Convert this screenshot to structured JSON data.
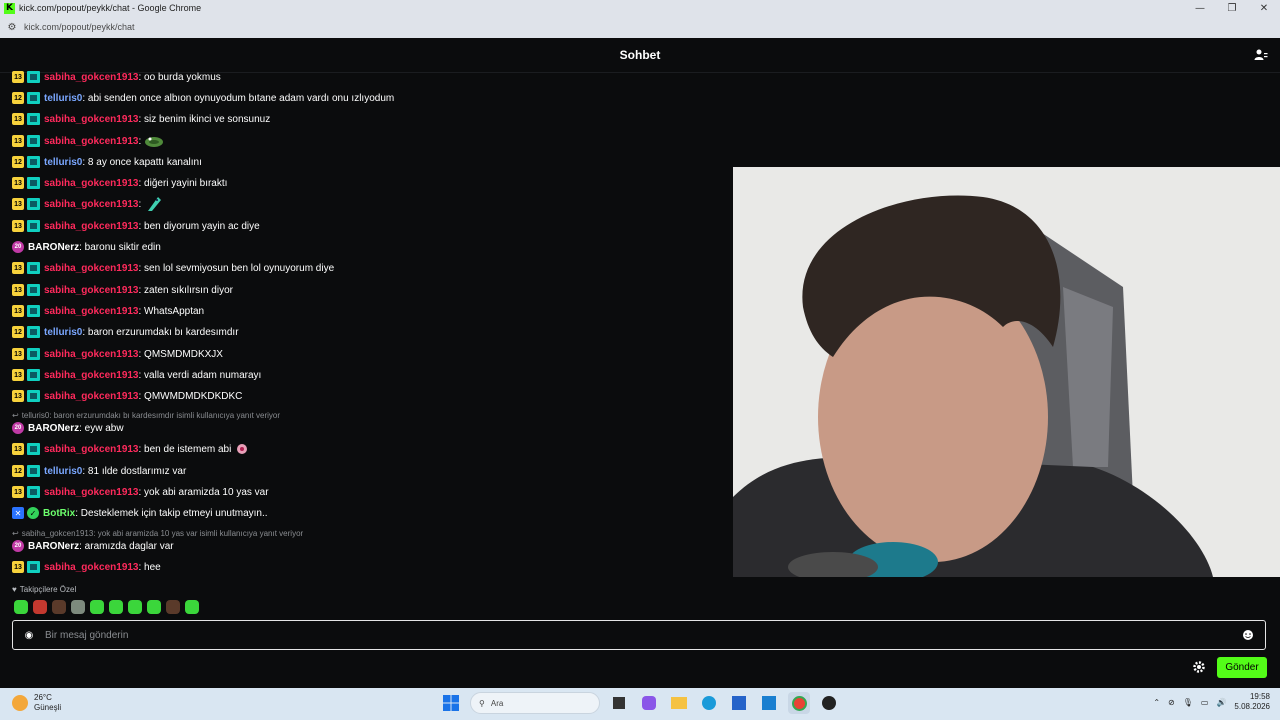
{
  "browser": {
    "window_title": "kick.com/popout/peykk/chat - Google Chrome",
    "url": "kick.com/popout/peykk/chat"
  },
  "chat": {
    "title": "Sohbet",
    "messages": [
      {
        "badge": "13",
        "user": "sabiha_gokcen1913",
        "color": "#ff2a5c",
        "text": ": oo burda yokmus"
      },
      {
        "badge": "12",
        "user": "telluris0",
        "color": "#7aa7ff",
        "text": ": abi senden once albıon oynuyodum bıtane adam vardı onu ızlıyodum"
      },
      {
        "badge": "13",
        "user": "sabiha_gokcen1913",
        "color": "#ff2a5c",
        "text": ": siz benim ikinci ve sonsunuz"
      },
      {
        "badge": "13",
        "user": "sabiha_gokcen1913",
        "color": "#ff2a5c",
        "text": ":",
        "emote": "frog-emote"
      },
      {
        "badge": "12",
        "user": "telluris0",
        "color": "#7aa7ff",
        "text": ": 8 ay once kapattı kanalını"
      },
      {
        "badge": "13",
        "user": "sabiha_gokcen1913",
        "color": "#ff2a5c",
        "text": ": diğeri yayini bıraktı"
      },
      {
        "badge": "13",
        "user": "sabiha_gokcen1913",
        "color": "#ff2a5c",
        "text": ":",
        "emote": "fish-emote"
      },
      {
        "badge": "13",
        "user": "sabiha_gokcen1913",
        "color": "#ff2a5c",
        "text": ": ben diyorum yayin ac diye"
      },
      {
        "badge": "20",
        "user": "BARONerz",
        "color": "#ffffff",
        "text": ": baronu siktir edin",
        "og": true
      },
      {
        "badge": "13",
        "user": "sabiha_gokcen1913",
        "color": "#ff2a5c",
        "text": ": sen lol sevmiyosun ben lol oynuyorum diye"
      },
      {
        "badge": "13",
        "user": "sabiha_gokcen1913",
        "color": "#ff2a5c",
        "text": ": zaten sıkılırsın diyor"
      },
      {
        "badge": "13",
        "user": "sabiha_gokcen1913",
        "color": "#ff2a5c",
        "text": ": WhatsApptan"
      },
      {
        "badge": "12",
        "user": "telluris0",
        "color": "#7aa7ff",
        "text": ": baron erzurumdakı bı kardesımdır"
      },
      {
        "badge": "13",
        "user": "sabiha_gokcen1913",
        "color": "#ff2a5c",
        "text": ": QMSMDMDKXJX"
      },
      {
        "badge": "13",
        "user": "sabiha_gokcen1913",
        "color": "#ff2a5c",
        "text": ": valla verdi adam numarayı"
      },
      {
        "badge": "13",
        "user": "sabiha_gokcen1913",
        "color": "#ff2a5c",
        "text": ": QMWMDMDKDKDKC"
      },
      {
        "badge": "20",
        "user": "BARONerz",
        "color": "#ffffff",
        "text": ": eyw abw",
        "og": true,
        "reply": "telluris0: baron erzurumdakı bı kardesımdır isimli kullanıcıya yanıt veriyor"
      },
      {
        "badge": "13",
        "user": "sabiha_gokcen1913",
        "color": "#ff2a5c",
        "text": ": ben de istemem abi",
        "emote": "face-emote"
      },
      {
        "badge": "12",
        "user": "telluris0",
        "color": "#7aa7ff",
        "text": ": 81 ılde dostlarımız var"
      },
      {
        "badge": "13",
        "user": "sabiha_gokcen1913",
        "color": "#ff2a5c",
        "text": ": yok abi aramizda 10 yas var"
      },
      {
        "badge": "",
        "user": "BotRix",
        "color": "#6dff6d",
        "text": ": Desteklemek için takip etmeyi unutmayın..",
        "bot": true
      },
      {
        "badge": "20",
        "user": "BARONerz",
        "color": "#ffffff",
        "text": ": aramızda daglar var",
        "og": true,
        "reply": "sabiha_gokcen1913: yok abi aramizda 10 yas var isimli kullanıcıya yanıt veriyor"
      },
      {
        "badge": "13",
        "user": "sabiha_gokcen1913",
        "color": "#ff2a5c",
        "text": ": hee"
      }
    ],
    "followers_label": "Takipçilere Özel",
    "input_placeholder": "Bir mesaj gönderin",
    "send_label": "Gönder"
  },
  "taskbar": {
    "weather_temp": "26°C",
    "weather_desc": "Güneşli",
    "search_placeholder": "Ara",
    "time": "19:58",
    "date": "5.08.2026"
  },
  "colors": {
    "accent": "#53fc18",
    "background": "#0b0c0d"
  }
}
